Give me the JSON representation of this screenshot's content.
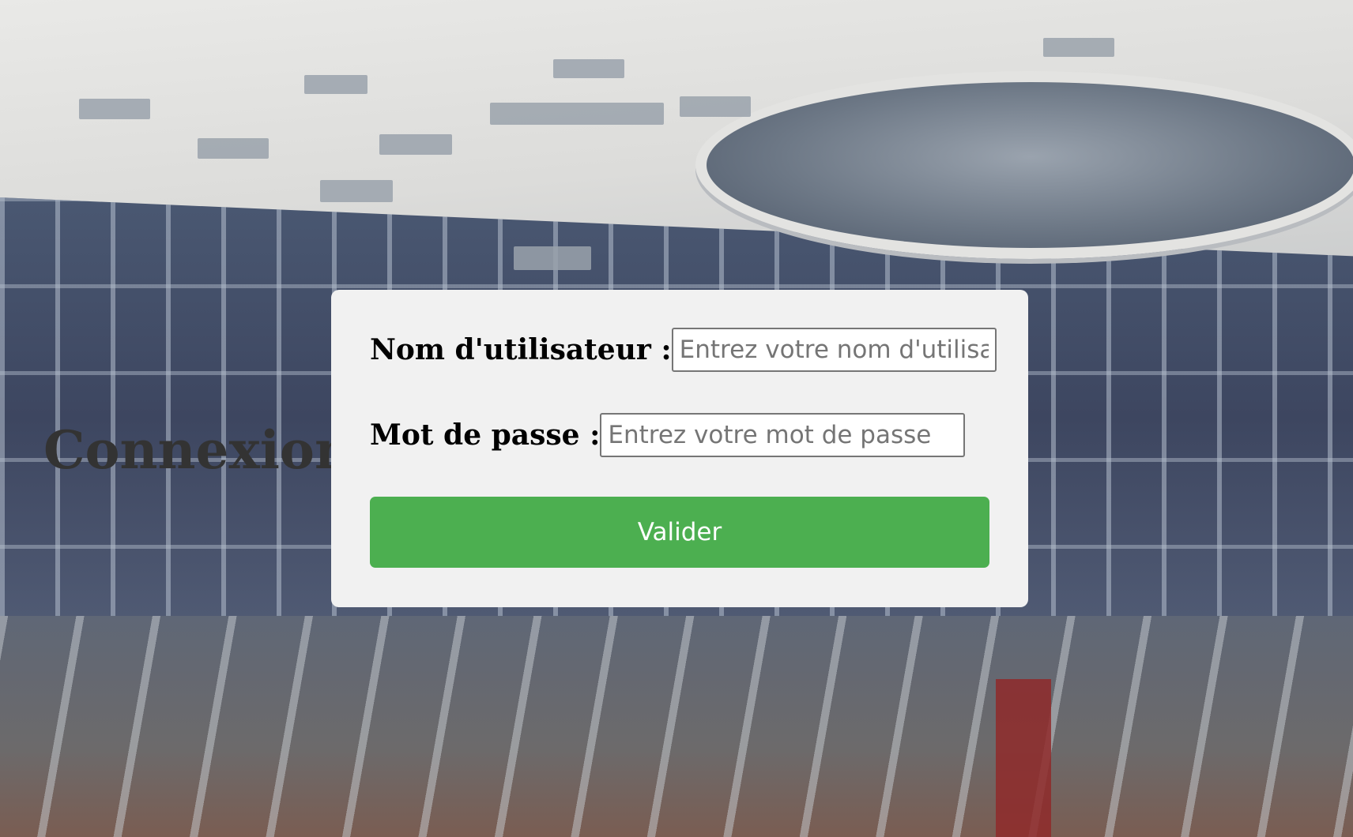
{
  "page": {
    "heading": "Connexion"
  },
  "form": {
    "username": {
      "label": "Nom d'utilisateur :",
      "placeholder": "Entrez votre nom d'utilisateur",
      "value": ""
    },
    "password": {
      "label": "Mot de passe :",
      "placeholder": "Entrez votre mot de passe",
      "value": ""
    },
    "submit_label": "Valider"
  },
  "colors": {
    "card_background": "#f1f1f1",
    "button_background": "#4caf50",
    "button_text": "#ffffff",
    "heading_text": "#333333"
  }
}
